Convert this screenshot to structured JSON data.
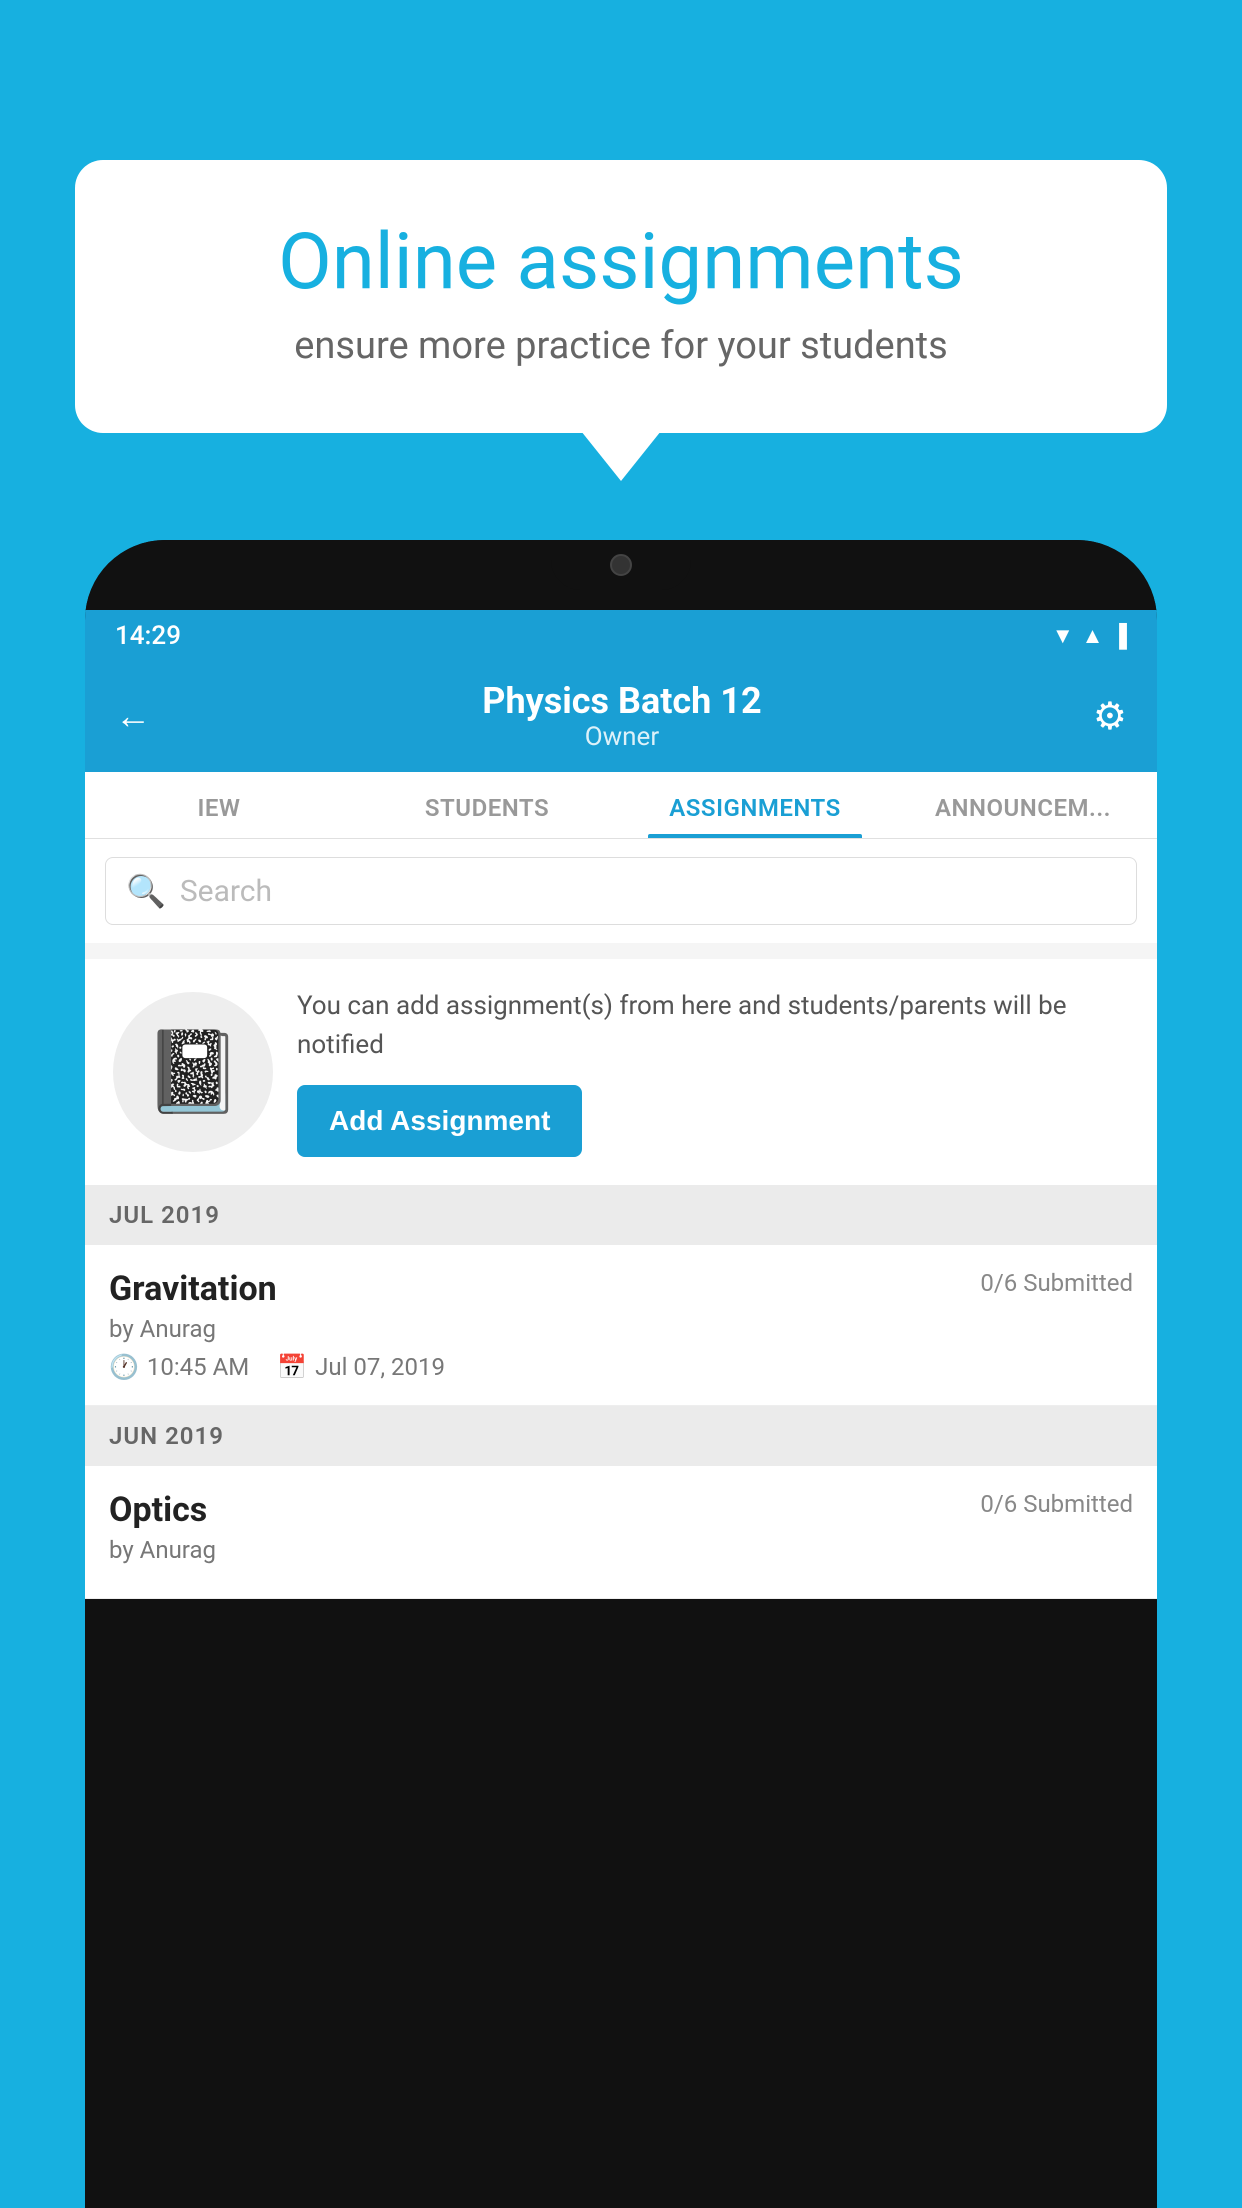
{
  "background_color": "#17b0e0",
  "speech_bubble": {
    "title": "Online assignments",
    "subtitle": "ensure more practice for your students"
  },
  "status_bar": {
    "time": "14:29",
    "icons": [
      "wifi",
      "signal",
      "battery"
    ]
  },
  "app_header": {
    "back_label": "←",
    "title": "Physics Batch 12",
    "subtitle": "Owner",
    "gear_label": "⚙"
  },
  "tabs": [
    {
      "label": "IEW",
      "active": false
    },
    {
      "label": "STUDENTS",
      "active": false
    },
    {
      "label": "ASSIGNMENTS",
      "active": true
    },
    {
      "label": "ANNOUNCEM...",
      "active": false
    }
  ],
  "search": {
    "placeholder": "Search"
  },
  "info_card": {
    "text": "You can add assignment(s) from here and students/parents will be notified",
    "button_label": "Add Assignment"
  },
  "sections": [
    {
      "title": "JUL 2019",
      "assignments": [
        {
          "name": "Gravitation",
          "submitted": "0/6 Submitted",
          "by": "by Anurag",
          "time": "10:45 AM",
          "date": "Jul 07, 2019"
        }
      ]
    },
    {
      "title": "JUN 2019",
      "assignments": [
        {
          "name": "Optics",
          "submitted": "0/6 Submitted",
          "by": "by Anurag",
          "time": "",
          "date": ""
        }
      ]
    }
  ]
}
